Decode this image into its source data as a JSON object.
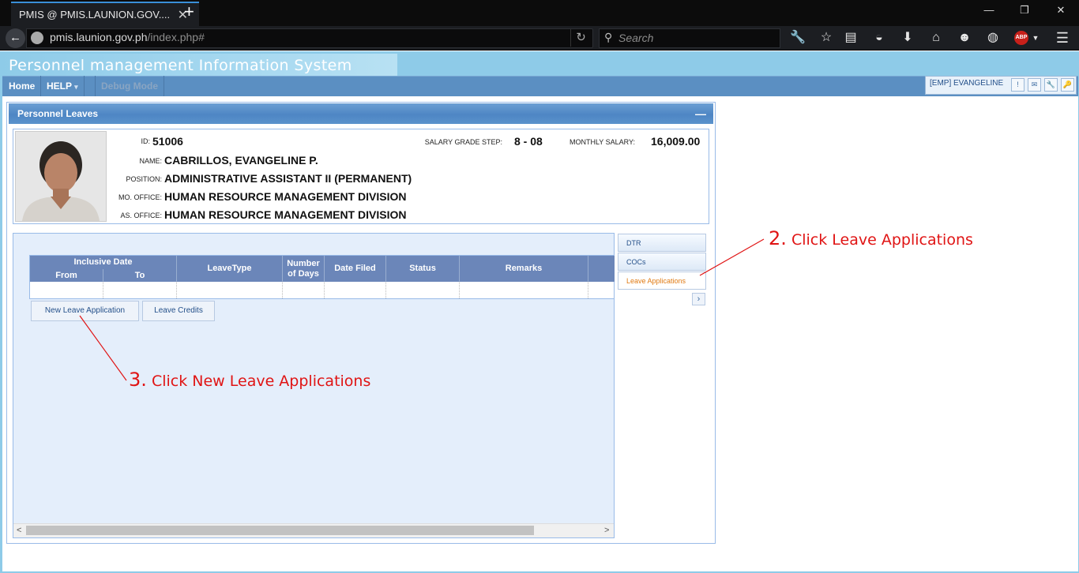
{
  "browser": {
    "tab_title": "PMIS @ PMIS.LAUNION.GOV....",
    "tab_close": "✕",
    "new_tab": "+",
    "url_domain": "pmis.launion.gov.ph",
    "url_path": "/index.php#",
    "search_placeholder": "Search",
    "window_min": "—",
    "window_restore": "❐",
    "window_close": "✕",
    "abp_label": "ABP"
  },
  "app": {
    "title": "Personnel management Information System",
    "menu": [
      "Home",
      "HELP",
      "Debug Mode"
    ],
    "menu_help_arrow": "▾",
    "user": "[EMP] EVANGELINE",
    "user_buttons": [
      "!",
      "✉",
      "🔧",
      "🔑"
    ]
  },
  "panel": {
    "title": "Personnel Leaves",
    "collapse": "—"
  },
  "employee": {
    "id_label": "ID:",
    "id": "51006",
    "name_label": "NAME:",
    "name": "CABRILLOS, EVANGELINE P.",
    "position_label": "POSITION:",
    "position": "ADMINISTRATIVE ASSISTANT II (PERMANENT)",
    "mo_office_label": "MO. OFFICE:",
    "mo_office": "HUMAN RESOURCE MANAGEMENT DIVISION",
    "as_office_label": "AS. OFFICE:",
    "as_office": "HUMAN RESOURCE MANAGEMENT DIVISION",
    "salary_grade_label": "SALARY GRADE STEP:",
    "salary_grade": "8 - 08",
    "monthly_salary_label": "MONTHLY SALARY:",
    "monthly_salary": "16,009.00"
  },
  "grid": {
    "inclusive_date": "Inclusive Date",
    "columns": [
      "From",
      "To",
      "LeaveType",
      "Number of Days",
      "Date Filed",
      "Status",
      "Remarks"
    ]
  },
  "buttons": {
    "new_leave": "New Leave Application",
    "leave_credits": "Leave Credits"
  },
  "side_tabs": [
    "DTR",
    "COCs",
    "Leave Applications"
  ],
  "side_arrow": "›",
  "scroll": {
    "left": "<",
    "right": ">"
  },
  "annotations": {
    "step2_num": "2.",
    "step2_text": "Click Leave Applications",
    "step3_num": "3.",
    "step3_text": "Click New Leave Applications",
    "color": "#e01414"
  }
}
